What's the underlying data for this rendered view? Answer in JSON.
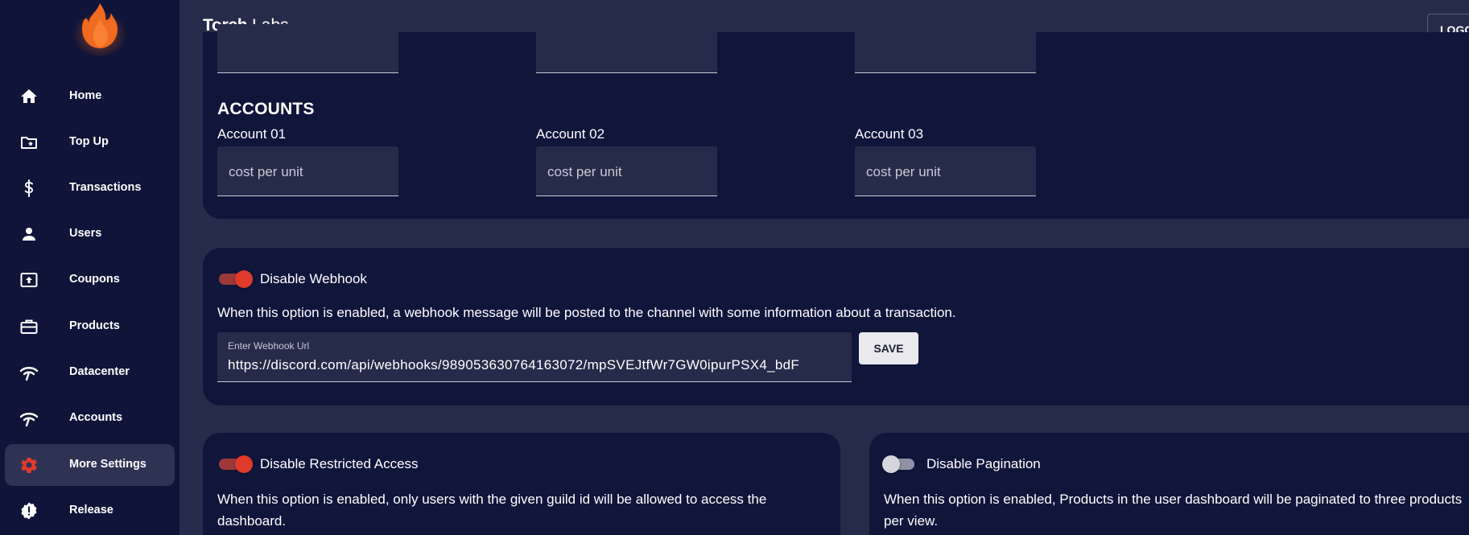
{
  "header": {
    "brand_bold": "Torch",
    "brand_regular": "Labs",
    "logout_label": "LOGOUT"
  },
  "sidebar": {
    "items": [
      {
        "label": "Home",
        "icon": "home-icon"
      },
      {
        "label": "Top Up",
        "icon": "star-folder-icon"
      },
      {
        "label": "Transactions",
        "icon": "dollar-icon"
      },
      {
        "label": "Users",
        "icon": "person-icon"
      },
      {
        "label": "Coupons",
        "icon": "upload-box-icon"
      },
      {
        "label": "Products",
        "icon": "briefcase-icon"
      },
      {
        "label": "Datacenter",
        "icon": "wifi-icon"
      },
      {
        "label": "Accounts",
        "icon": "wifi-icon"
      },
      {
        "label": "More Settings",
        "icon": "gear-icon",
        "active": true
      },
      {
        "label": "Release",
        "icon": "alert-badge-icon"
      }
    ]
  },
  "accounts": {
    "title": "ACCOUNTS",
    "items": [
      {
        "label": "Account 01",
        "placeholder": "cost per unit"
      },
      {
        "label": "Account 02",
        "placeholder": "cost per unit"
      },
      {
        "label": "Account 03",
        "placeholder": "cost per unit"
      }
    ]
  },
  "webhook": {
    "toggle_label": "Disable Webhook",
    "enabled": true,
    "description": "When this option is enabled, a webhook message will be posted to the channel with some information about a transaction.",
    "input_label": "Enter Webhook Url",
    "input_value": "https://discord.com/api/webhooks/989053630764163072/mpSVEJtfWr7GW0ipurPSX4_bdF",
    "save_label": "SAVE"
  },
  "restricted": {
    "toggle_label": "Disable Restricted Access",
    "enabled": true,
    "description": "When this option is enabled, only users with the given guild id will be allowed to access the dashboard."
  },
  "pagination": {
    "toggle_label": "Disable Pagination",
    "enabled": false,
    "description": "When this option is enabled, Products in the user dashboard will be paginated to three products per view."
  },
  "colors": {
    "sidebar_bg": "#0f1438",
    "page_bg": "#272b4a",
    "card_bg": "#10153a",
    "accent_red": "#e03a2c",
    "logo_orange": "#f06a1f"
  }
}
